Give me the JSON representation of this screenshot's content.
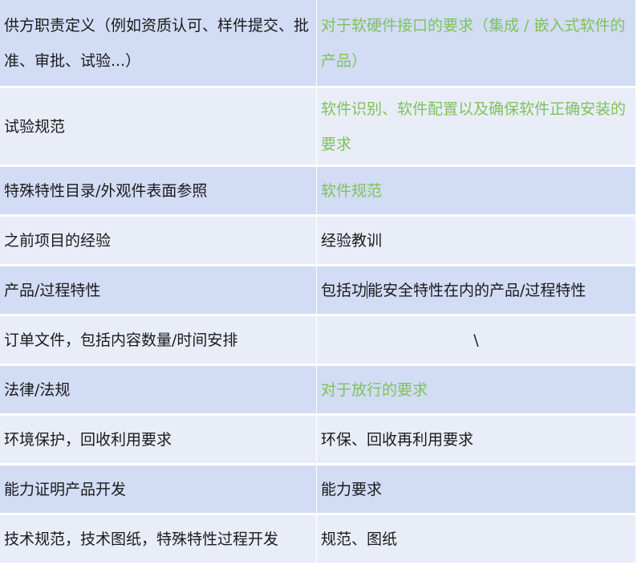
{
  "rows": [
    {
      "left": "供方职责定义（例如资质认可、样件提交、批准、审批、试验...）",
      "right": "对于软硬件接口的要求（集成 / 嵌入式软件的产品）"
    },
    {
      "left": "试验规范",
      "right": "软件识别、软件配置以及确保软件正确安装的要求"
    },
    {
      "left": "特殊特性目录/外观件表面参照",
      "right": "软件规范"
    },
    {
      "left": "之前项目的经验",
      "right": "经验教训"
    },
    {
      "left": "产品/过程特性",
      "right_a": "包括功",
      "right_b": "能安全特性在内的产品/过程特性"
    },
    {
      "left": "订单文件，包括内容数量/时间安排",
      "right": "\\"
    },
    {
      "left": "法律/法规",
      "right": "对于放行的要求"
    },
    {
      "left": "环境保护，回收利用要求",
      "right": "环保、回收再利用要求"
    },
    {
      "left": "能力证明产品开发",
      "right": "能力要求"
    },
    {
      "left": "技术规范，技术图纸，特殊特性过程开发",
      "right": "规范、图纸"
    }
  ],
  "colors": {
    "row_dark": "#d2dcf5",
    "row_light": "#e9edf8",
    "green_text": "#7fc25a"
  }
}
